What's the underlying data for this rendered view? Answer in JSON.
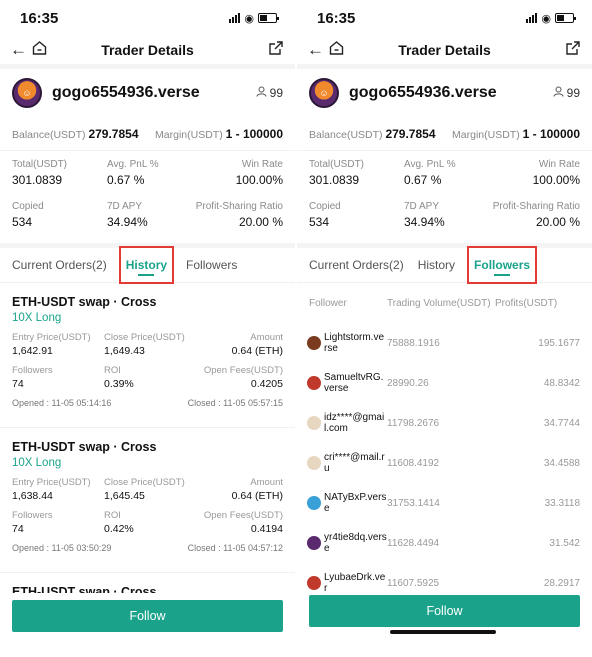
{
  "status": {
    "time": "16:35"
  },
  "nav": {
    "title": "Trader Details"
  },
  "profile": {
    "name": "gogo6554936.verse",
    "followers_count": "99"
  },
  "balance": {
    "balance_label": "Balance(USDT)",
    "balance_value": "279.7854",
    "margin_label": "Margin(USDT)",
    "margin_value": "1 - 100000"
  },
  "stats": {
    "total_label": "Total(USDT)",
    "total_value": "301.0839",
    "pnl_label": "Avg. PnL %",
    "pnl_value": "0.67 %",
    "winrate_label": "Win Rate",
    "winrate_value": "100.00%",
    "copied_label": "Copied",
    "copied_value": "534",
    "apy_label": "7D APY",
    "apy_value": "34.94%",
    "share_label": "Profit-Sharing Ratio",
    "share_value": "20.00 %"
  },
  "tabs": {
    "current": "Current Orders(2)",
    "history": "History",
    "followers": "Followers"
  },
  "orders": [
    {
      "title": "ETH-USDT swap · Cross",
      "leverage": "10X Long",
      "entry_label": "Entry Price(USDT)",
      "entry": "1,642.91",
      "close_label": "Close Price(USDT)",
      "close": "1,649.43",
      "amount_label": "Amount",
      "amount": "0.64 (ETH)",
      "followers_label": "Followers",
      "followers": "74",
      "roi_label": "ROI",
      "roi": "0.39%",
      "fees_label": "Open Fees(USDT)",
      "fees": "0.4205",
      "opened": "Opened : 11-05 05:14:16",
      "closed": "Closed : 11-05 05:57:15"
    },
    {
      "title": "ETH-USDT swap · Cross",
      "leverage": "10X Long",
      "entry_label": "Entry Price(USDT)",
      "entry": "1,638.44",
      "close_label": "Close Price(USDT)",
      "close": "1,645.45",
      "amount_label": "Amount",
      "amount": "0.64 (ETH)",
      "followers_label": "Followers",
      "followers": "74",
      "roi_label": "ROI",
      "roi": "0.42%",
      "fees_label": "Open Fees(USDT)",
      "fees": "0.4194",
      "opened": "Opened : 11-05 03:50:29",
      "closed": "Closed : 11-05 04:57:12"
    },
    {
      "title": "ETH-USDT swap · Cross"
    }
  ],
  "followers_table": {
    "headers": {
      "follower": "Follower",
      "volume": "Trading Volume(USDT)",
      "profits": "Profits(USDT)"
    },
    "rows": [
      {
        "name": "Lightstorm.verse",
        "volume": "75888.1916",
        "profit": "195.1677",
        "avatar_color": "#7a3b1f"
      },
      {
        "name": "SamueltvRG.verse",
        "volume": "28990.26",
        "profit": "48.8342",
        "avatar_color": "#c0392b"
      },
      {
        "name": "idz****@gmail.com",
        "volume": "11798.2676",
        "profit": "34.7744",
        "avatar_color": "#e8d7c0"
      },
      {
        "name": "cri****@mail.ru",
        "volume": "11608.4192",
        "profit": "34.4588",
        "avatar_color": "#e8d7c0"
      },
      {
        "name": "NATyBxP.verse",
        "volume": "31753.1414",
        "profit": "33.3118",
        "avatar_color": "#3aa0d8"
      },
      {
        "name": "yr4tie8dq.verse",
        "volume": "11628.4494",
        "profit": "31.542",
        "avatar_color": "#5a2a6e"
      },
      {
        "name": "LyubaeDrk.ver",
        "volume": "11607.5925",
        "profit": "28.2917",
        "avatar_color": "#c0392b"
      }
    ]
  },
  "footer": {
    "follow_label": "Follow"
  },
  "colors": {
    "accent": "#1aa38a",
    "highlight_box": "#e53935"
  }
}
